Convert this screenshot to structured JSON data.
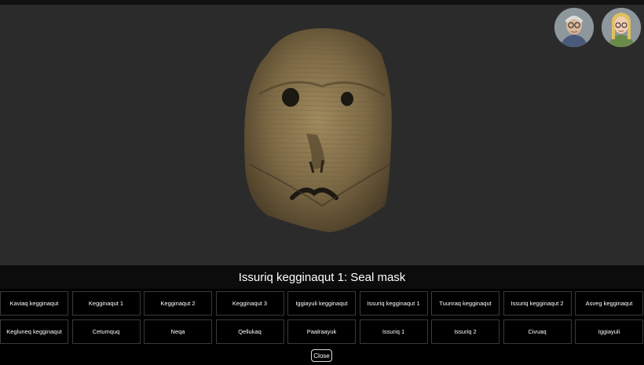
{
  "viewer": {
    "mask_image": "seal-mask-3d-model",
    "avatars": [
      {
        "name": "elder-narrator-avatar"
      },
      {
        "name": "young-narrator-avatar"
      }
    ]
  },
  "title": "Issuriq kegginaqut 1: Seal mask",
  "masks_row1": [
    "Kaviaq kegginaqut",
    "Kegginaqut 1",
    "Kegginaqut 2",
    "Kegginaqut 3",
    "Iggiayuli kegginaqut",
    "Issuriq kegginaqut 1",
    "Tuunraq kegginaqut",
    "Issuriq kegginaqut 2",
    "Asveg kegginaqut"
  ],
  "masks_row2": [
    "Kegluneq kegginaqut",
    "Cetumquq",
    "Neqa",
    "Qellukaq",
    "Paalraayuk",
    "Issuriq 1",
    "Issuriq 2",
    "Civuaq",
    "Iggiayuli"
  ],
  "close_label": "Close"
}
